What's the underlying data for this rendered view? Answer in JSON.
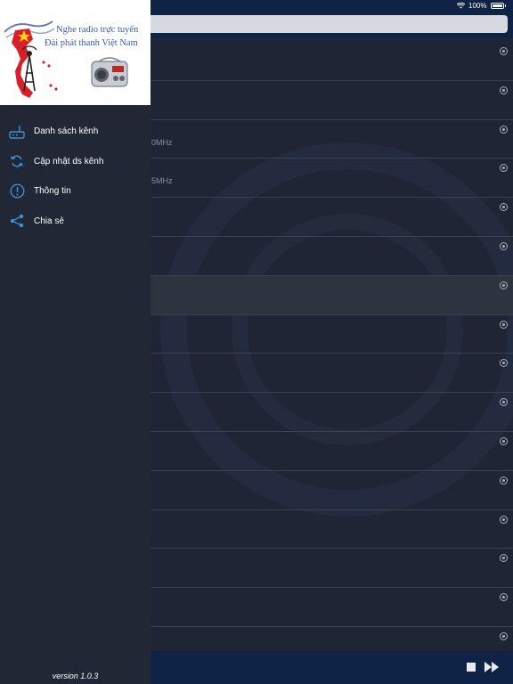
{
  "status": {
    "battery": "100%"
  },
  "drawer": {
    "banner": {
      "title_line1": "Nghe radio trực tuyến",
      "title_line2": "Đài phát thanh Việt Nam"
    },
    "menu": [
      {
        "label": "Danh sách kênh",
        "icon": "radio-icon"
      },
      {
        "label": "Cập nhật ds kênh",
        "icon": "refresh-icon"
      },
      {
        "label": "Thông tin",
        "icon": "info-icon"
      },
      {
        "label": "Chia sẻ",
        "icon": "share-icon"
      }
    ],
    "version": "version 1.0.3"
  },
  "channels": {
    "rows": [
      {
        "sub": ""
      },
      {
        "sub": ""
      },
      {
        "sub": "0MHz"
      },
      {
        "sub": "5MHz"
      },
      {
        "sub": ""
      },
      {
        "sub": ""
      },
      {
        "sub": "",
        "selected": true
      },
      {
        "sub": ""
      },
      {
        "sub": ""
      },
      {
        "sub": ""
      },
      {
        "sub": ""
      },
      {
        "sub": ""
      },
      {
        "sub": ""
      },
      {
        "sub": ""
      },
      {
        "sub": ""
      },
      {
        "sub": ""
      }
    ]
  },
  "colors": {
    "navbar": "#0f2346",
    "drawer_bg": "#222735",
    "accent_icon": "#3c8fd6",
    "banner_text": "#3b5aa6"
  }
}
